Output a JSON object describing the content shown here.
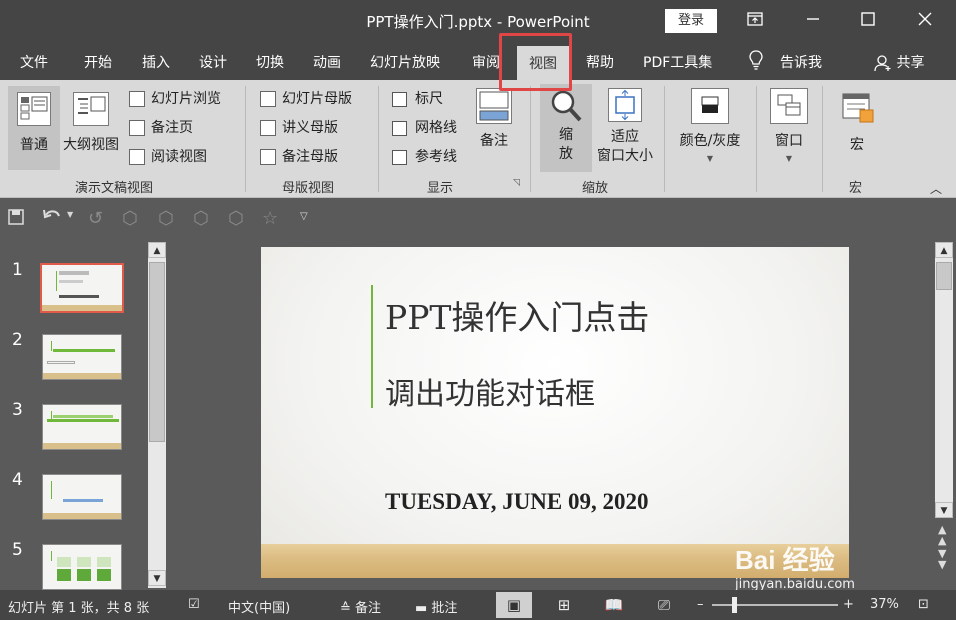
{
  "window": {
    "title": "PPT操作入门.pptx  -  PowerPoint",
    "login": "登录"
  },
  "tabs": [
    "文件",
    "开始",
    "插入",
    "设计",
    "切换",
    "动画",
    "幻灯片放映",
    "审阅",
    "视图",
    "帮助",
    "PDF工具集",
    "告诉我",
    "共享"
  ],
  "active_tab": "视图",
  "ribbon": {
    "presentation_views": {
      "label": "演示文稿视图",
      "normal": "普通",
      "outline": "大纲视图",
      "slide_sorter": "幻灯片浏览",
      "notes_page": "备注页",
      "reading_view": "阅读视图"
    },
    "master_views": {
      "label": "母版视图",
      "slide_master": "幻灯片母版",
      "handout_master": "讲义母版",
      "notes_master": "备注母版"
    },
    "show": {
      "label": "显示",
      "ruler": "标尺",
      "gridlines": "网格线",
      "guides": "参考线",
      "notes": "备注"
    },
    "zoom": {
      "label": "缩放",
      "zoom_top": "缩",
      "zoom_bottom": "放",
      "fit_top": "适应",
      "fit_bottom": "窗口大小"
    },
    "color": {
      "label": "颜色/灰度"
    },
    "window": {
      "label": "窗口"
    },
    "macros": {
      "label": "宏",
      "button": "宏"
    }
  },
  "thumbnails": [
    {
      "num": "1",
      "selected": true
    },
    {
      "num": "2",
      "selected": false
    },
    {
      "num": "3",
      "selected": false
    },
    {
      "num": "4",
      "selected": false
    },
    {
      "num": "5",
      "selected": false
    }
  ],
  "slide": {
    "title": "PPT操作入门点击",
    "subtitle": "调出功能对话框",
    "date": "TUESDAY, JUNE 09, 2020",
    "accent_color": "#6fb83a"
  },
  "status": {
    "slide_info": "幻灯片 第 1 张，共 8 张",
    "language": "中文(中国)",
    "notes": "备注",
    "comments": "批注",
    "zoom_level": "37%"
  },
  "watermark": {
    "brand": "Bai 经验",
    "url": "jingyan.baidu.com"
  },
  "colors": {
    "titlebar": "#454545",
    "ribbon": "#d9d9d9",
    "highlight": "#e04646"
  }
}
